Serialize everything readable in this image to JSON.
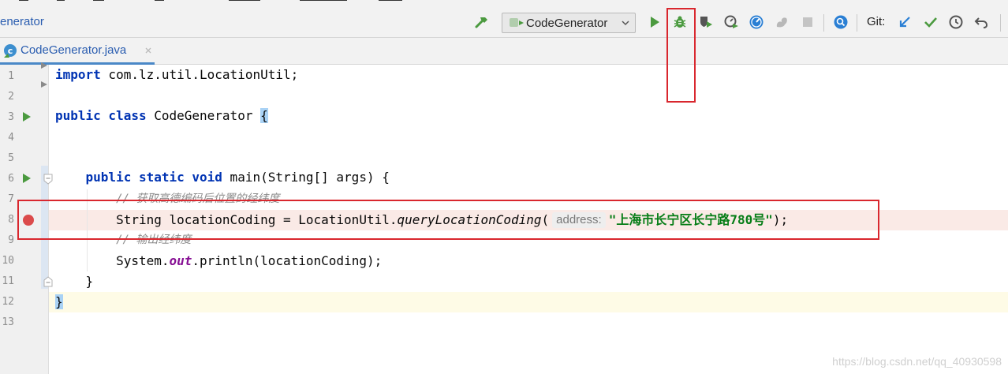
{
  "window": {
    "project_title": "enerator"
  },
  "toolbar": {
    "build_icon": "hammer-icon",
    "run_config": "CodeGenerator",
    "run_icon": "play-icon",
    "debug_icon": "bug-icon",
    "coverage_icon": "shield-run-icon",
    "profile_icon": "profiler-icon",
    "attach_icon": "attach-debugger-icon",
    "squirrel_icon": "squirrel-icon",
    "stop_icon": "stop-icon",
    "search_icon": "search-everywhere-icon",
    "git_label": "Git:",
    "git_update_icon": "arrow-down-left-icon",
    "git_commit_icon": "checkmark-icon",
    "git_history_icon": "clock-icon",
    "git_rollback_icon": "undo-icon"
  },
  "tabs": [
    {
      "label": "CodeGenerator.java",
      "icon": "java-class-icon",
      "active": true
    }
  ],
  "editor": {
    "line_numbers": [
      "1",
      "2",
      "3",
      "4",
      "5",
      "6",
      "7",
      "8",
      "9",
      "10",
      "11",
      "12",
      "13"
    ],
    "code": {
      "l1_kw": "import",
      "l1_rest": " com.lz.util.LocationUtil;",
      "l3_kw": "public class",
      "l3_rest": " CodeGenerator ",
      "l3_brace": "{",
      "l6_indent": "    ",
      "l6_kw": "public static void",
      "l6_rest": " main(String[] args) {",
      "l7_indent": "        ",
      "l7_comment": "// 获取高德编码后位置的经纬度",
      "l8_indent": "        ",
      "l8_a": "String locationCoding = LocationUtil.",
      "l8_method": "queryLocationCoding",
      "l8_paren": "(",
      "l8_hint": "address:",
      "l8_string": "\"上海市长宁区长宁路780号\"",
      "l8_end": ");",
      "l9_indent": "        ",
      "l9_comment": "// 输出经纬度",
      "l10_indent": "        ",
      "l10_a": "System.",
      "l10_field": "out",
      "l10_b": ".println(locationCoding);",
      "l11": "    }",
      "l12_brace": "}"
    },
    "breakpoint_line": 8,
    "run_gutter_lines": [
      3,
      6
    ]
  },
  "watermark": "https://blog.csdn.net/qq_40930598",
  "colors": {
    "keyword": "#0033b3",
    "string": "#067d17",
    "comment": "#8c8c8c",
    "breakpoint": "#db4b4b",
    "annotation": "#d9272e"
  }
}
